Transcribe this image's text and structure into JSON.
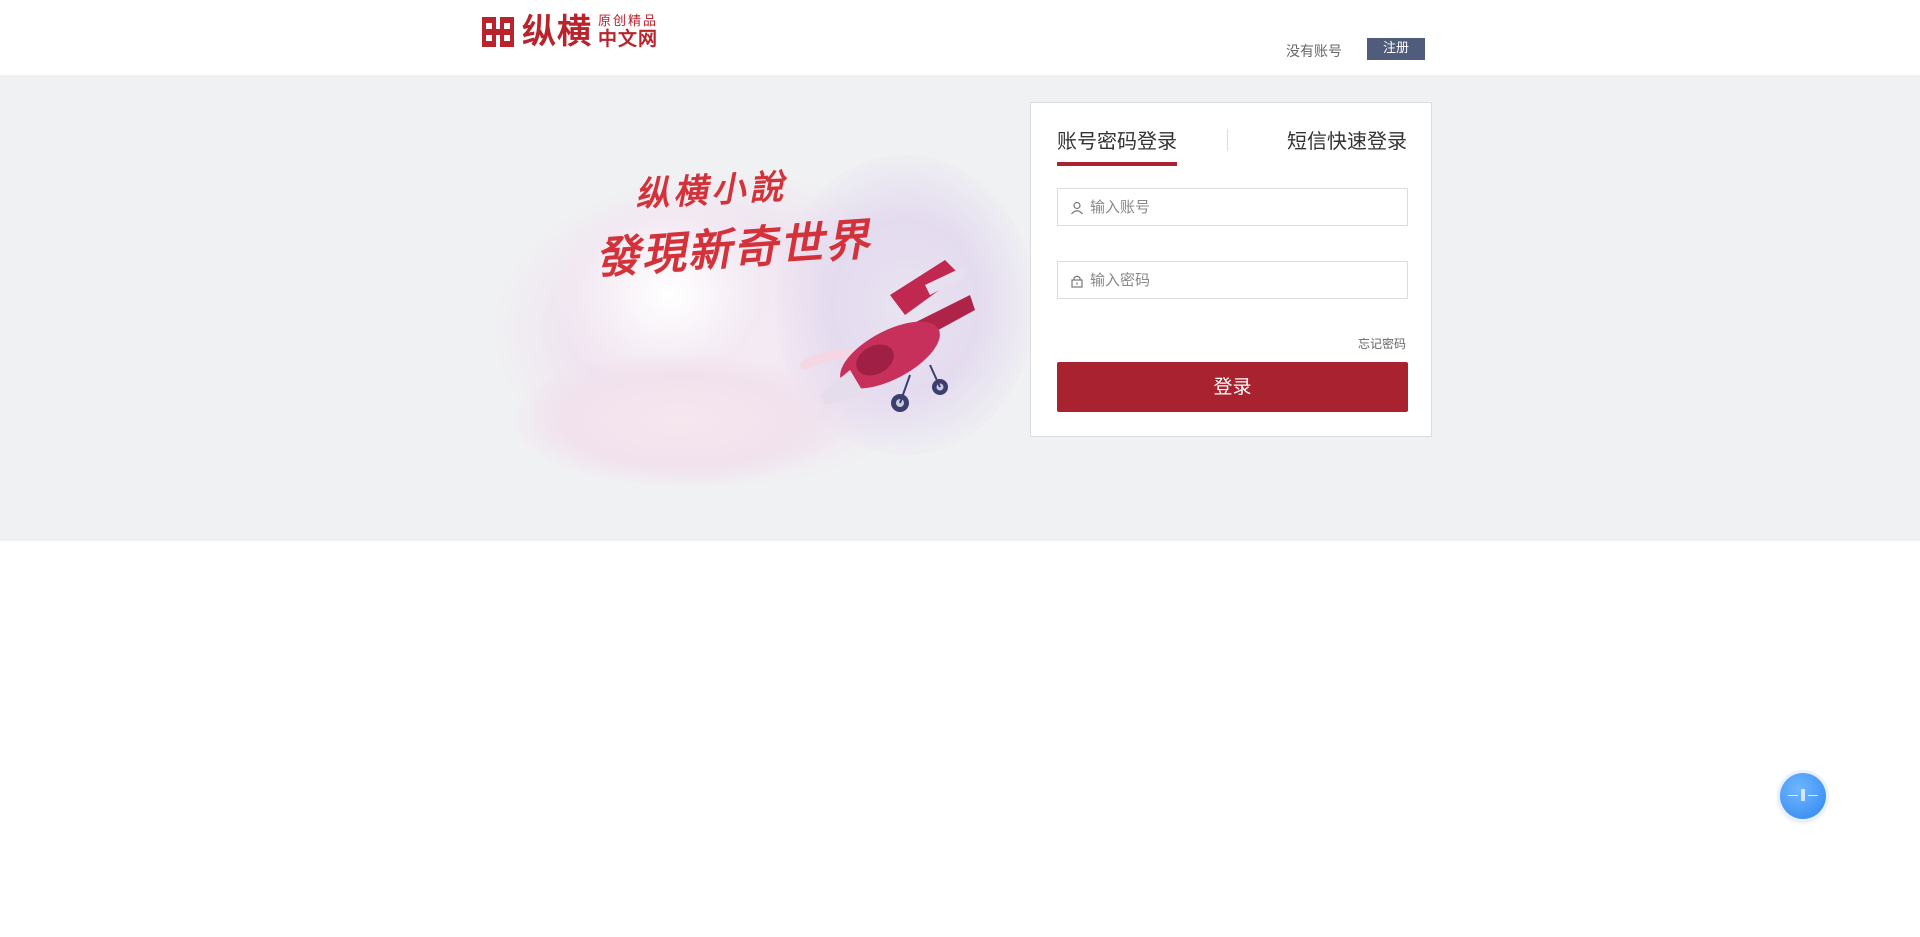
{
  "header": {
    "logo": {
      "main": "纵横",
      "sub_top": "原创精品",
      "sub_bottom": "中文网"
    },
    "no_account_text": "没有账号",
    "register_label": "注册"
  },
  "hero": {
    "slogan_line1": "纵横小說",
    "slogan_line2": "發現新奇世界"
  },
  "login": {
    "tabs": [
      {
        "label": "账号密码登录",
        "active": true
      },
      {
        "label": "短信快速登录",
        "active": false
      }
    ],
    "account_placeholder": "输入账号",
    "password_placeholder": "输入密码",
    "forgot_label": "忘记密码",
    "submit_label": "登录"
  },
  "colors": {
    "brand": "#a8222f",
    "register_bg": "#4f5c7c",
    "band_bg": "#f0f1f3"
  },
  "icons": [
    "user-icon",
    "lock-icon",
    "assistant-float-icon"
  ]
}
